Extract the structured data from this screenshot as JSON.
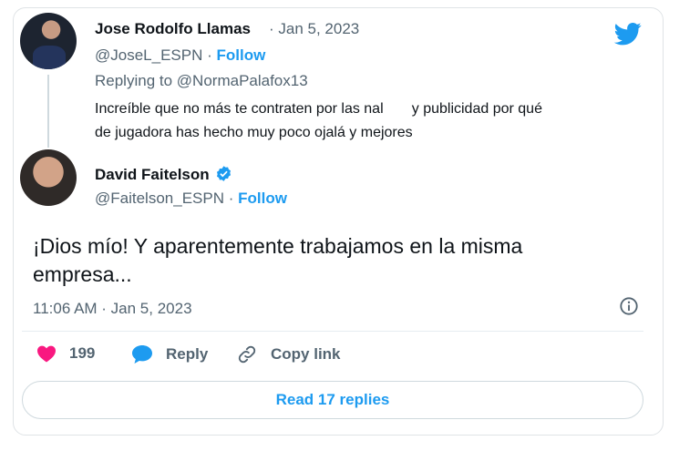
{
  "reply_tweet": {
    "author_name": "Jose Rodolfo Llamas",
    "date": "Jan 5, 2023",
    "handle": "@JoseL_ESPN",
    "follow_label": "Follow",
    "replying_to_prefix": "Replying to",
    "replying_to_handle": "@NormaPalafox13",
    "text_line1": "Increíble que no más te contraten por las nal       y publicidad por qué",
    "text_line2": "de jugadora has hecho muy poco ojalá y mejores"
  },
  "main_tweet": {
    "author_name": "David Faitelson",
    "handle": "@Faitelson_ESPN",
    "follow_label": "Follow",
    "text_line1": "¡Dios mío! Y aparentemente trabajamos en la misma",
    "text_line2": "empresa...",
    "timestamp": "11:06 AM · Jan 5, 2023"
  },
  "actions": {
    "like_count": "199",
    "reply_label": "Reply",
    "copy_link_label": "Copy link",
    "read_replies_label": "Read 17 replies"
  },
  "colors": {
    "accent": "#1d9bf0",
    "like": "#f91880",
    "muted": "#536471"
  },
  "icons": [
    "twitter-bird-icon",
    "verified-badge-icon",
    "heart-icon",
    "reply-bubble-icon",
    "link-icon",
    "info-icon"
  ]
}
